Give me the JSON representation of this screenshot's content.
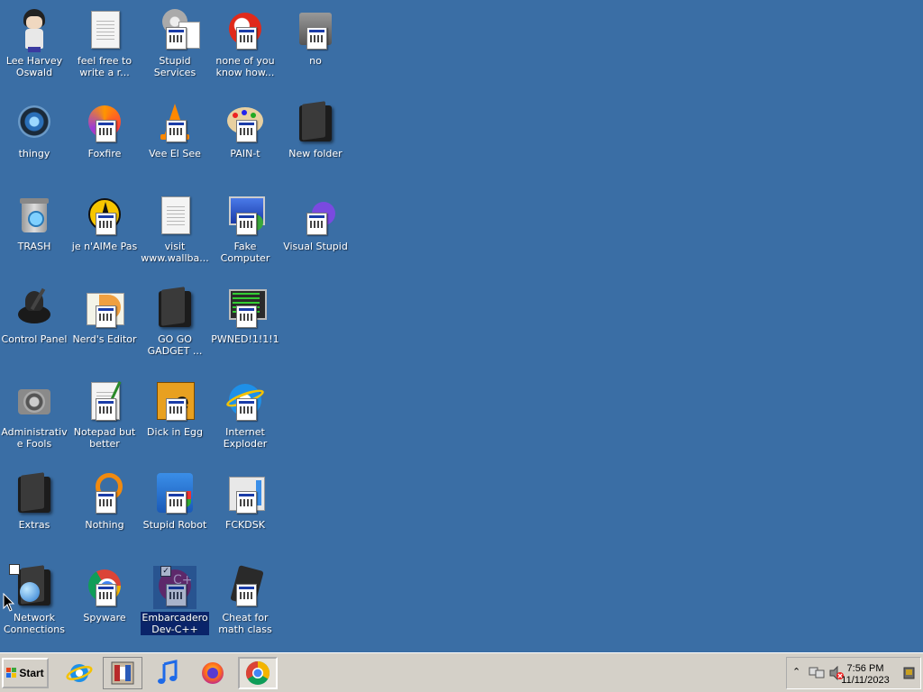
{
  "desktop": {
    "icons": [
      {
        "label": "Lee Harvey Oswald",
        "icon": "character-icon"
      },
      {
        "label": "feel free to write a r...",
        "icon": "text-document-icon"
      },
      {
        "label": "Stupid Services",
        "icon": "services-gear-icon"
      },
      {
        "label": "none of you know how...",
        "icon": "red-globe-icon"
      },
      {
        "label": "no",
        "icon": "box-icon"
      },
      {
        "label": "thingy",
        "icon": "webcam-icon"
      },
      {
        "label": "Foxfire",
        "icon": "firefox-icon"
      },
      {
        "label": "Vee El See",
        "icon": "vlc-cone-icon"
      },
      {
        "label": "PAIN-t",
        "icon": "paint-palette-icon"
      },
      {
        "label": "New folder",
        "icon": "folder-icon"
      },
      {
        "label": "TRASH",
        "icon": "recycle-bin-icon"
      },
      {
        "label": "je n'AIMe Pas",
        "icon": "aim-icon"
      },
      {
        "label": "visit www.wallba...",
        "icon": "text-document-icon"
      },
      {
        "label": "Fake Computer",
        "icon": "remote-desktop-icon"
      },
      {
        "label": "Visual Stupid",
        "icon": "visual-studio-icon"
      },
      {
        "label": "Control Panel",
        "icon": "control-panel-icon"
      },
      {
        "label": "Nerd's Editor",
        "icon": "notepad-plus-icon"
      },
      {
        "label": "GO GO GADGET ...",
        "icon": "folder-icon"
      },
      {
        "label": "PWNED!1!1!1",
        "icon": "terminal-icon"
      },
      {
        "label": "Administrative Fools",
        "icon": "admin-tools-icon"
      },
      {
        "label": "Notepad but better",
        "icon": "notepad-icon"
      },
      {
        "label": "Dick in Egg",
        "icon": "e-editor-icon"
      },
      {
        "label": "Internet Exploder",
        "icon": "internet-explorer-icon"
      },
      {
        "label": "Extras",
        "icon": "folder-icon"
      },
      {
        "label": "Nothing",
        "icon": "orange-ring-icon"
      },
      {
        "label": "Stupid Robot",
        "icon": "robot-shield-icon"
      },
      {
        "label": "FCKDSK",
        "icon": "disk-check-icon"
      },
      {
        "label": "Network Connections",
        "icon": "network-folder-icon"
      },
      {
        "label": "Spyware",
        "icon": "chrome-icon"
      },
      {
        "label": "Embarcadero Dev-C++",
        "icon": "devcpp-icon",
        "selected": true
      },
      {
        "label": "Cheat for math class",
        "icon": "calculator-icon"
      }
    ]
  },
  "taskbar": {
    "start_label": "Start",
    "pinned": [
      {
        "name": "internet-explorer-icon"
      },
      {
        "name": "film-strip-icon"
      },
      {
        "name": "music-note-icon"
      },
      {
        "name": "firefox-icon"
      },
      {
        "name": "chrome-icon",
        "active": true
      }
    ],
    "tray": {
      "time": "7:56 PM",
      "date": "11/11/2023"
    }
  },
  "colors": {
    "desktop_bg": "#3a6ea5",
    "taskbar_bg": "#d4d0c8",
    "selection": "#0a246a"
  }
}
